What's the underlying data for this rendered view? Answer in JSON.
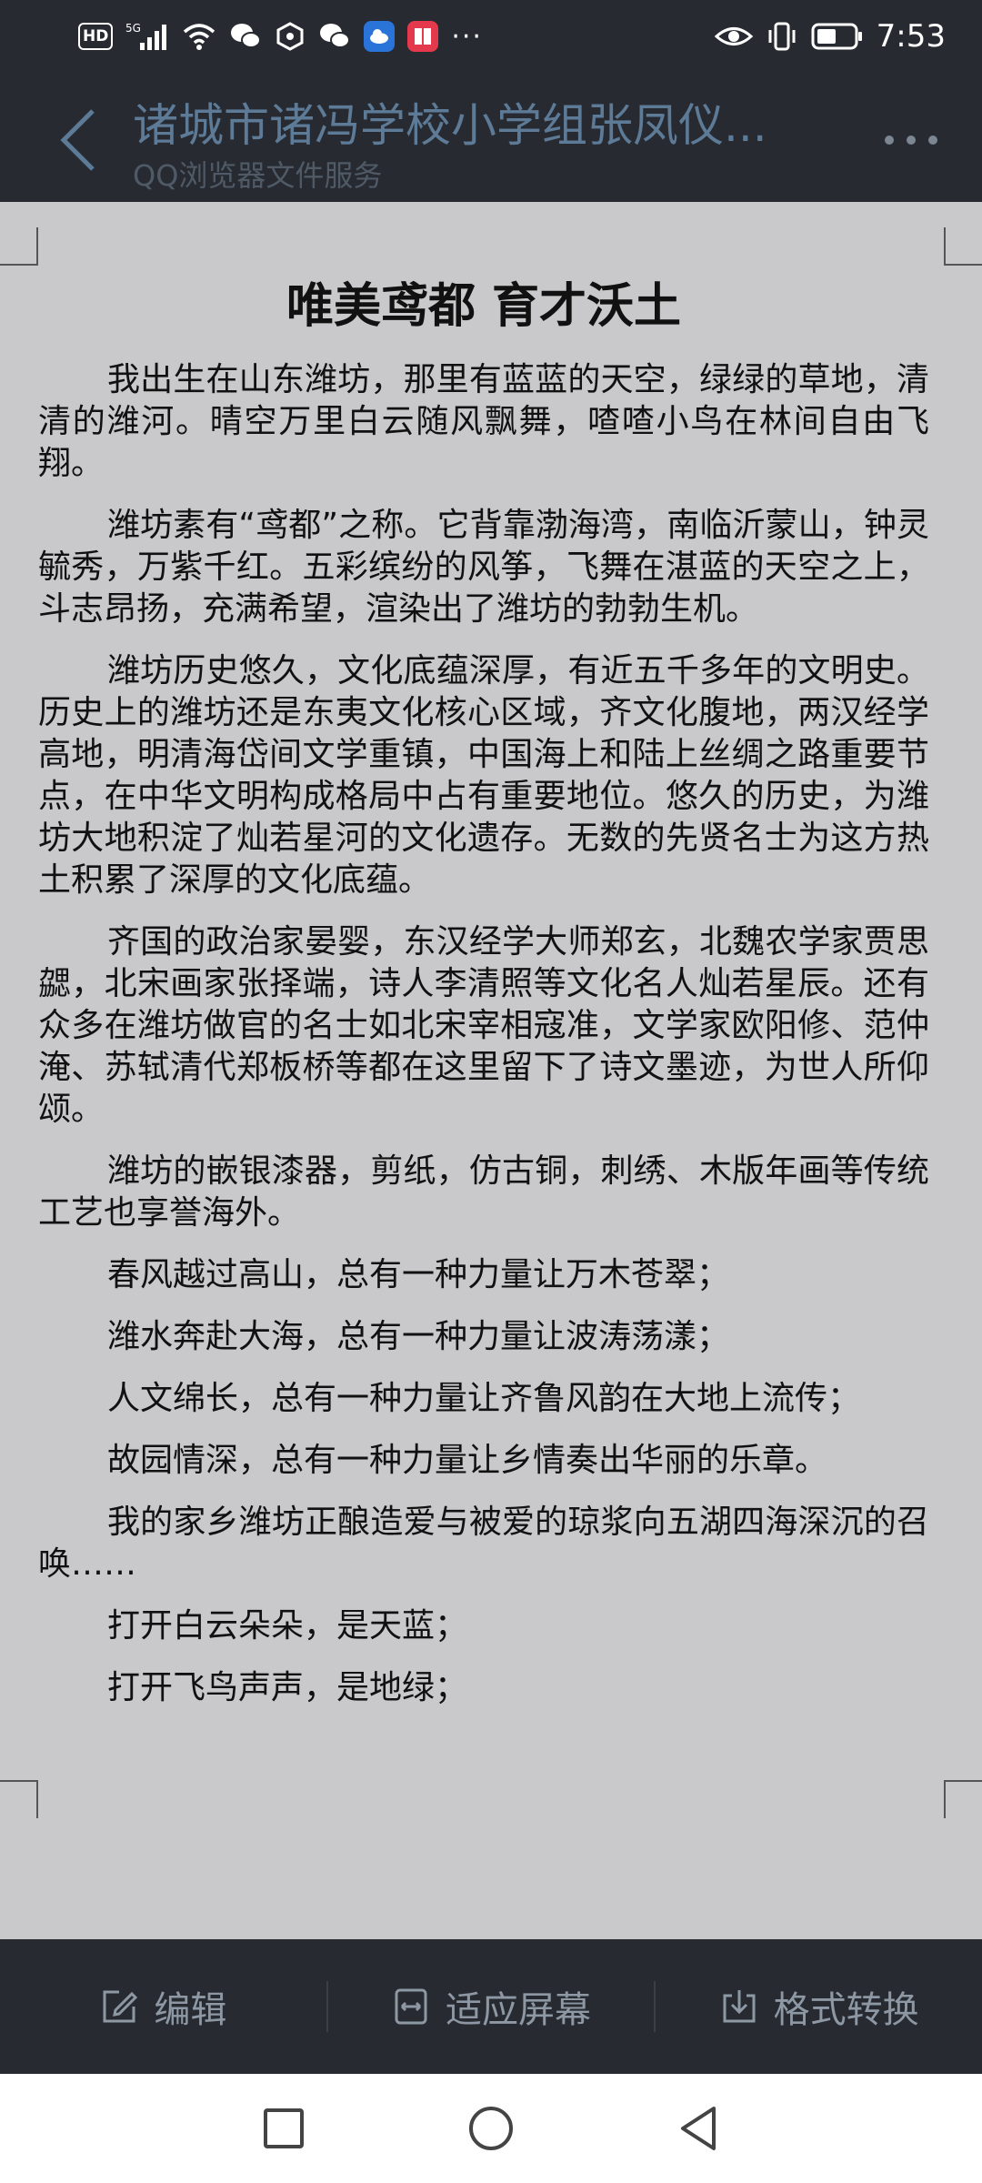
{
  "status_bar": {
    "hd": "HD",
    "network": "5G",
    "more": "···",
    "time": "7:53"
  },
  "header": {
    "title": "诸城市诸冯学校小学组张凤仪...",
    "subtitle": "QQ浏览器文件服务"
  },
  "document": {
    "title": "唯美鸢都 育才沃土",
    "paragraphs": [
      "我出生在山东潍坊，那里有蓝蓝的天空，绿绿的草地，清清的潍河。晴空万里白云随风飘舞，喳喳小鸟在林间自由飞翔。",
      "潍坊素有“鸢都”之称。它背靠渤海湾，南临沂蒙山，钟灵毓秀，万紫千红。五彩缤纷的风筝，飞舞在湛蓝的天空之上，斗志昂扬，充满希望，渲染出了潍坊的勃勃生机。",
      "潍坊历史悠久，文化底蕴深厚，有近五千多年的文明史。历史上的潍坊还是东夷文化核心区域，齐文化腹地，两汉经学高地，明清海岱间文学重镇，中国海上和陆上丝绸之路重要节点，在中华文明构成格局中占有重要地位。悠久的历史，为潍坊大地积淀了灿若星河的文化遗存。无数的先贤名士为这方热土积累了深厚的文化底蕴。",
      "齐国的政治家晏婴，东汉经学大师郑玄，北魏农学家贾思勰，北宋画家张择端，诗人李清照等文化名人灿若星辰。还有众多在潍坊做官的名士如北宋宰相寇准，文学家欧阳修、范仲淹、苏轼清代郑板桥等都在这里留下了诗文墨迹，为世人所仰颂。",
      "潍坊的嵌银漆器，剪纸，仿古铜，刺绣、木版年画等传统工艺也享誉海外。",
      "春风越过高山，总有一种力量让万木苍翠；",
      "潍水奔赴大海，总有一种力量让波涛荡漾；",
      "人文绵长，总有一种力量让齐鲁风韵在大地上流传；",
      "故园情深，总有一种力量让乡情奏出华丽的乐章。",
      "我的家乡潍坊正酿造爱与被爱的琼浆向五湖四海深沉的召唤……",
      "打开白云朵朵，是天蓝；",
      "打开飞鸟声声，是地绿；"
    ]
  },
  "toolbar": {
    "edit": "编辑",
    "fit_screen": "适应屏幕",
    "convert": "格式转换"
  }
}
